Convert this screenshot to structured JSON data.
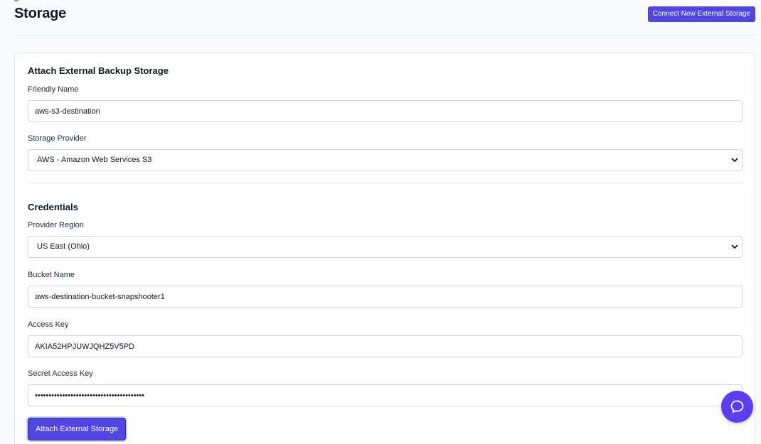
{
  "header": {
    "title": "Storage",
    "connect_button": "Connect New External Storage"
  },
  "form": {
    "section_title": "Attach External Backup Storage",
    "friendly_name": {
      "label": "Friendly Name",
      "value": "aws-s3-destination"
    },
    "storage_provider": {
      "label": "Storage Provider",
      "selected": "AWS - Amazon Web Services S3"
    },
    "credentials_title": "Credentials",
    "provider_region": {
      "label": "Provider Region",
      "selected": "US East (Ohio)"
    },
    "bucket_name": {
      "label": "Bucket Name",
      "value": "aws-destination-bucket-snapshooter1"
    },
    "access_key": {
      "label": "Access Key",
      "value": "AKIA52HPJUWJQHZ5V5PD"
    },
    "secret_access_key": {
      "label": "Secret Access Key",
      "value": "••••••••••••••••••••••••••••••••••••••••"
    },
    "submit_button": "Attach External Storage"
  },
  "icons": {
    "select_chevron": "chevron-down-icon",
    "chat": "chat-bubble-icon"
  },
  "colors": {
    "primary": "#4f46e5",
    "chat_bubble": "#5b3df5"
  }
}
